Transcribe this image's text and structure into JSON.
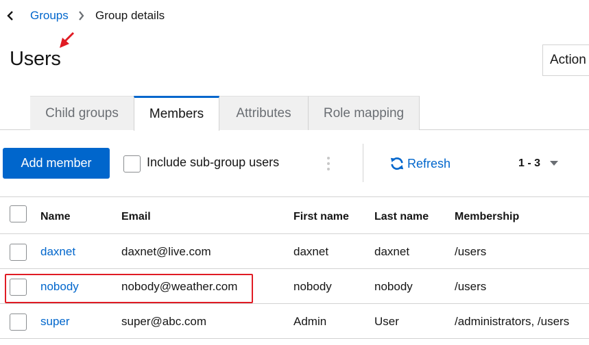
{
  "breadcrumb": {
    "parent": "Groups",
    "current": "Group details"
  },
  "page": {
    "title": "Users",
    "action_label": "Action"
  },
  "tabs": [
    {
      "label": "Child groups",
      "active": false
    },
    {
      "label": "Members",
      "active": true
    },
    {
      "label": "Attributes",
      "active": false
    },
    {
      "label": "Role mapping",
      "active": false
    }
  ],
  "toolbar": {
    "add_member_label": "Add member",
    "include_subgroup_label": "Include sub-group users",
    "refresh_label": "Refresh",
    "pagination_label": "1 - 3"
  },
  "table": {
    "columns": [
      "Name",
      "Email",
      "First name",
      "Last name",
      "Membership"
    ],
    "rows": [
      {
        "name": "daxnet",
        "email": "daxnet@live.com",
        "first_name": "daxnet",
        "last_name": "daxnet",
        "membership": "/users"
      },
      {
        "name": "nobody",
        "email": "nobody@weather.com",
        "first_name": "nobody",
        "last_name": "nobody",
        "membership": "/users"
      },
      {
        "name": "super",
        "email": "super@abc.com",
        "first_name": "Admin",
        "last_name": "User",
        "membership": "/administrators, /users"
      }
    ]
  },
  "colors": {
    "primary": "#0066cc",
    "annotation": "#e01b24",
    "border": "#d2d2d2"
  },
  "icons": [
    "chevron-left-icon",
    "chevron-right-icon",
    "sync-icon",
    "caret-down-icon",
    "kebab-icon",
    "arrow-annotation-icon"
  ]
}
